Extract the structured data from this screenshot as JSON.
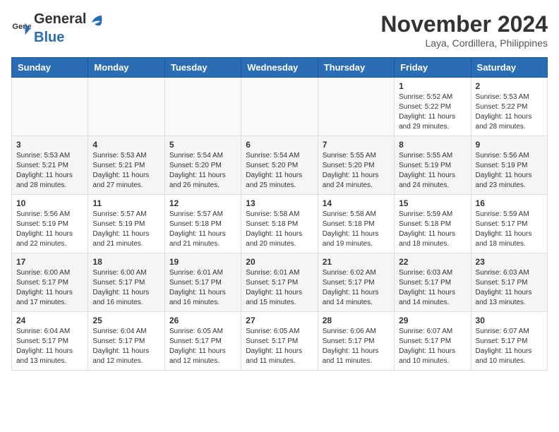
{
  "header": {
    "logo_general": "General",
    "logo_blue": "Blue",
    "month_year": "November 2024",
    "location": "Laya, Cordillera, Philippines"
  },
  "calendar": {
    "days_of_week": [
      "Sunday",
      "Monday",
      "Tuesday",
      "Wednesday",
      "Thursday",
      "Friday",
      "Saturday"
    ],
    "weeks": [
      [
        {
          "day": "",
          "info": ""
        },
        {
          "day": "",
          "info": ""
        },
        {
          "day": "",
          "info": ""
        },
        {
          "day": "",
          "info": ""
        },
        {
          "day": "",
          "info": ""
        },
        {
          "day": "1",
          "info": "Sunrise: 5:52 AM\nSunset: 5:22 PM\nDaylight: 11 hours\nand 29 minutes."
        },
        {
          "day": "2",
          "info": "Sunrise: 5:53 AM\nSunset: 5:22 PM\nDaylight: 11 hours\nand 28 minutes."
        }
      ],
      [
        {
          "day": "3",
          "info": "Sunrise: 5:53 AM\nSunset: 5:21 PM\nDaylight: 11 hours\nand 28 minutes."
        },
        {
          "day": "4",
          "info": "Sunrise: 5:53 AM\nSunset: 5:21 PM\nDaylight: 11 hours\nand 27 minutes."
        },
        {
          "day": "5",
          "info": "Sunrise: 5:54 AM\nSunset: 5:20 PM\nDaylight: 11 hours\nand 26 minutes."
        },
        {
          "day": "6",
          "info": "Sunrise: 5:54 AM\nSunset: 5:20 PM\nDaylight: 11 hours\nand 25 minutes."
        },
        {
          "day": "7",
          "info": "Sunrise: 5:55 AM\nSunset: 5:20 PM\nDaylight: 11 hours\nand 24 minutes."
        },
        {
          "day": "8",
          "info": "Sunrise: 5:55 AM\nSunset: 5:19 PM\nDaylight: 11 hours\nand 24 minutes."
        },
        {
          "day": "9",
          "info": "Sunrise: 5:56 AM\nSunset: 5:19 PM\nDaylight: 11 hours\nand 23 minutes."
        }
      ],
      [
        {
          "day": "10",
          "info": "Sunrise: 5:56 AM\nSunset: 5:19 PM\nDaylight: 11 hours\nand 22 minutes."
        },
        {
          "day": "11",
          "info": "Sunrise: 5:57 AM\nSunset: 5:19 PM\nDaylight: 11 hours\nand 21 minutes."
        },
        {
          "day": "12",
          "info": "Sunrise: 5:57 AM\nSunset: 5:18 PM\nDaylight: 11 hours\nand 21 minutes."
        },
        {
          "day": "13",
          "info": "Sunrise: 5:58 AM\nSunset: 5:18 PM\nDaylight: 11 hours\nand 20 minutes."
        },
        {
          "day": "14",
          "info": "Sunrise: 5:58 AM\nSunset: 5:18 PM\nDaylight: 11 hours\nand 19 minutes."
        },
        {
          "day": "15",
          "info": "Sunrise: 5:59 AM\nSunset: 5:18 PM\nDaylight: 11 hours\nand 18 minutes."
        },
        {
          "day": "16",
          "info": "Sunrise: 5:59 AM\nSunset: 5:17 PM\nDaylight: 11 hours\nand 18 minutes."
        }
      ],
      [
        {
          "day": "17",
          "info": "Sunrise: 6:00 AM\nSunset: 5:17 PM\nDaylight: 11 hours\nand 17 minutes."
        },
        {
          "day": "18",
          "info": "Sunrise: 6:00 AM\nSunset: 5:17 PM\nDaylight: 11 hours\nand 16 minutes."
        },
        {
          "day": "19",
          "info": "Sunrise: 6:01 AM\nSunset: 5:17 PM\nDaylight: 11 hours\nand 16 minutes."
        },
        {
          "day": "20",
          "info": "Sunrise: 6:01 AM\nSunset: 5:17 PM\nDaylight: 11 hours\nand 15 minutes."
        },
        {
          "day": "21",
          "info": "Sunrise: 6:02 AM\nSunset: 5:17 PM\nDaylight: 11 hours\nand 14 minutes."
        },
        {
          "day": "22",
          "info": "Sunrise: 6:03 AM\nSunset: 5:17 PM\nDaylight: 11 hours\nand 14 minutes."
        },
        {
          "day": "23",
          "info": "Sunrise: 6:03 AM\nSunset: 5:17 PM\nDaylight: 11 hours\nand 13 minutes."
        }
      ],
      [
        {
          "day": "24",
          "info": "Sunrise: 6:04 AM\nSunset: 5:17 PM\nDaylight: 11 hours\nand 13 minutes."
        },
        {
          "day": "25",
          "info": "Sunrise: 6:04 AM\nSunset: 5:17 PM\nDaylight: 11 hours\nand 12 minutes."
        },
        {
          "day": "26",
          "info": "Sunrise: 6:05 AM\nSunset: 5:17 PM\nDaylight: 11 hours\nand 12 minutes."
        },
        {
          "day": "27",
          "info": "Sunrise: 6:05 AM\nSunset: 5:17 PM\nDaylight: 11 hours\nand 11 minutes."
        },
        {
          "day": "28",
          "info": "Sunrise: 6:06 AM\nSunset: 5:17 PM\nDaylight: 11 hours\nand 11 minutes."
        },
        {
          "day": "29",
          "info": "Sunrise: 6:07 AM\nSunset: 5:17 PM\nDaylight: 11 hours\nand 10 minutes."
        },
        {
          "day": "30",
          "info": "Sunrise: 6:07 AM\nSunset: 5:17 PM\nDaylight: 11 hours\nand 10 minutes."
        }
      ]
    ]
  }
}
